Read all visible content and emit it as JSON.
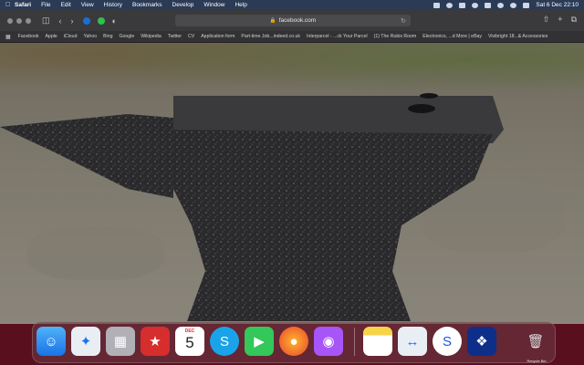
{
  "menubar": {
    "app_name": "Safari",
    "items": [
      "File",
      "Edit",
      "View",
      "History",
      "Bookmarks",
      "Develop",
      "Window",
      "Help"
    ],
    "clock": "Sat 6 Dec  22:10"
  },
  "toolbar": {
    "address": "facebook.com"
  },
  "bookmarks": [
    "Facebook",
    "Apple",
    "iCloud",
    "Yahoo",
    "Bing",
    "Google",
    "Wikipedia",
    "Twitter",
    "CV",
    "Application form",
    "Part-time Job...indeed.co.uk",
    "Interparcel - ...ck Your Parcel",
    "(1) The Rubix Room",
    "Electronics, ...d More | eBay",
    "Vivibright 18...& Accessories"
  ],
  "dock": {
    "calendar_month": "DEC",
    "calendar_day": "5",
    "trash_label": "Recycle Bin"
  },
  "colors": {
    "menubar": "#2b3a55",
    "toolbar": "#3a3a3c",
    "dock_background": "#5a0f1e"
  }
}
